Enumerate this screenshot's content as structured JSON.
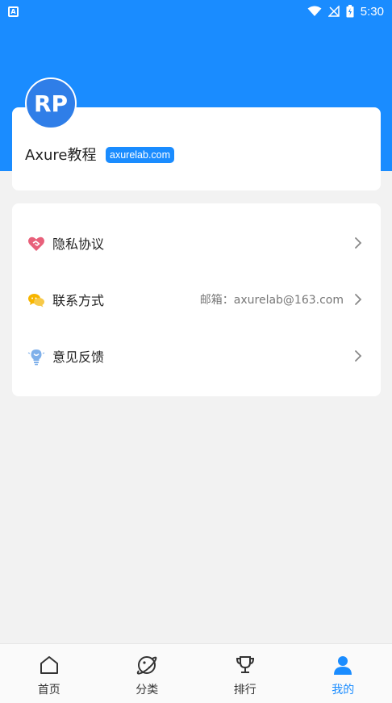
{
  "status_bar": {
    "time": "5:30"
  },
  "profile": {
    "avatar_initials": "RP",
    "name": "Axure教程",
    "badge": "axurelab.com"
  },
  "menu": [
    {
      "icon": "heart-handshake-icon",
      "label": "隐私协议",
      "value": ""
    },
    {
      "icon": "chat-bubbles-icon",
      "label": "联系方式",
      "value": "邮箱：axurelab@163.com"
    },
    {
      "icon": "lightbulb-icon",
      "label": "意见反馈",
      "value": ""
    }
  ],
  "tabs": [
    {
      "label": "首页",
      "icon": "home-icon",
      "active": false
    },
    {
      "label": "分类",
      "icon": "planet-icon",
      "active": false
    },
    {
      "label": "排行",
      "icon": "trophy-icon",
      "active": false
    },
    {
      "label": "我的",
      "icon": "user-icon",
      "active": true
    }
  ],
  "colors": {
    "primary": "#1a8cff",
    "avatar": "#2f7ee8",
    "background": "#f2f2f2"
  }
}
